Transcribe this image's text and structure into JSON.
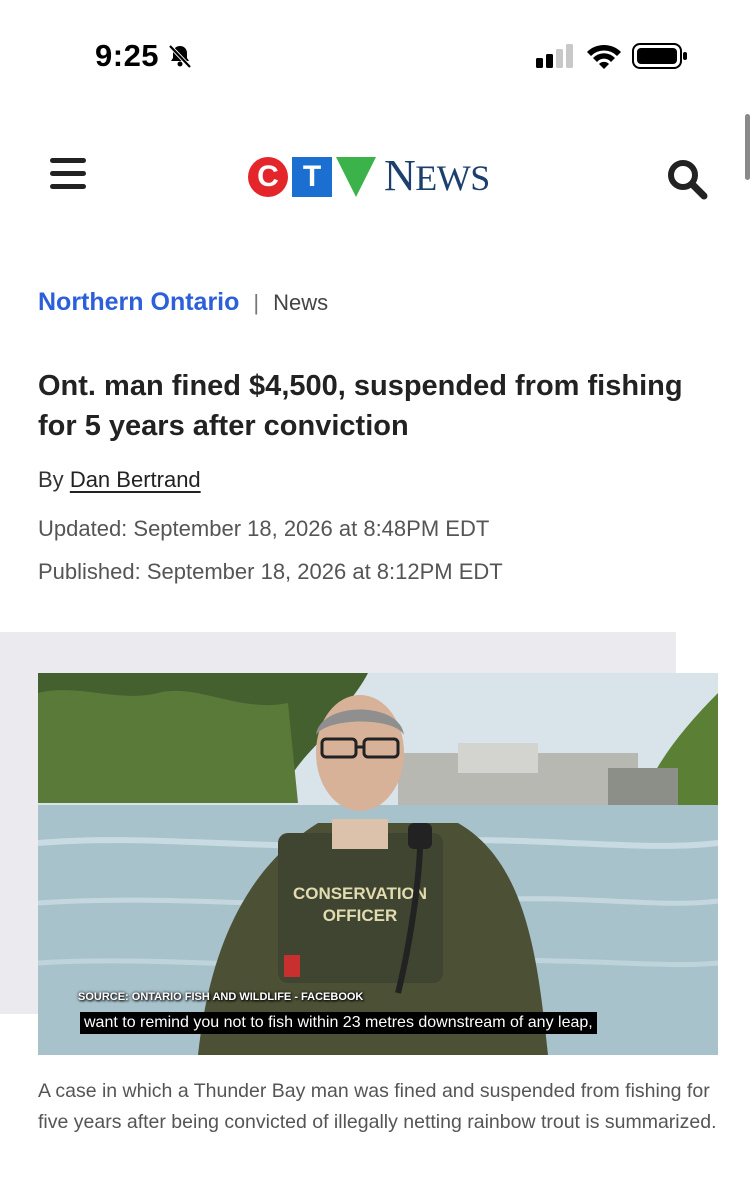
{
  "status_bar": {
    "time": "9:25",
    "icons": [
      "bell-slash-icon",
      "signal-icon",
      "wifi-icon",
      "battery-icon"
    ]
  },
  "header": {
    "logo": {
      "letters": [
        "C",
        "T",
        "V"
      ],
      "wordmark": "NEWS"
    },
    "icons": [
      "menu-icon",
      "search-icon"
    ]
  },
  "breadcrumb": {
    "section": "Northern Ontario",
    "separator": "|",
    "subsection": "News"
  },
  "article": {
    "headline": "Ont. man fined $4,500, suspended from fishing for 5 years after conviction",
    "byline_prefix": "By",
    "author": "Dan Bertrand",
    "updated": "Updated: September 18, 2026 at 8:48PM EDT",
    "published": "Published: September 18, 2026 at 8:12PM EDT"
  },
  "media": {
    "source_label": "SOURCE: ONTARIO FISH AND WILDLIFE - FACEBOOK",
    "subtitle": "want to remind you not to fish within 23 metres downstream of any leap,",
    "vest_text_line1": "CONSERVATION",
    "vest_text_line2": "OFFICER",
    "caption": "A case in which a Thunder Bay man was fined and suspended from fishing for five years after being convicted of illegally netting rainbow trout is summarized."
  },
  "colors": {
    "section_link": "#2c5fd9",
    "logo_red": "#e4262b",
    "logo_blue": "#1a6fd1",
    "logo_green": "#3cb34a",
    "logo_text": "#1c3f6e"
  }
}
